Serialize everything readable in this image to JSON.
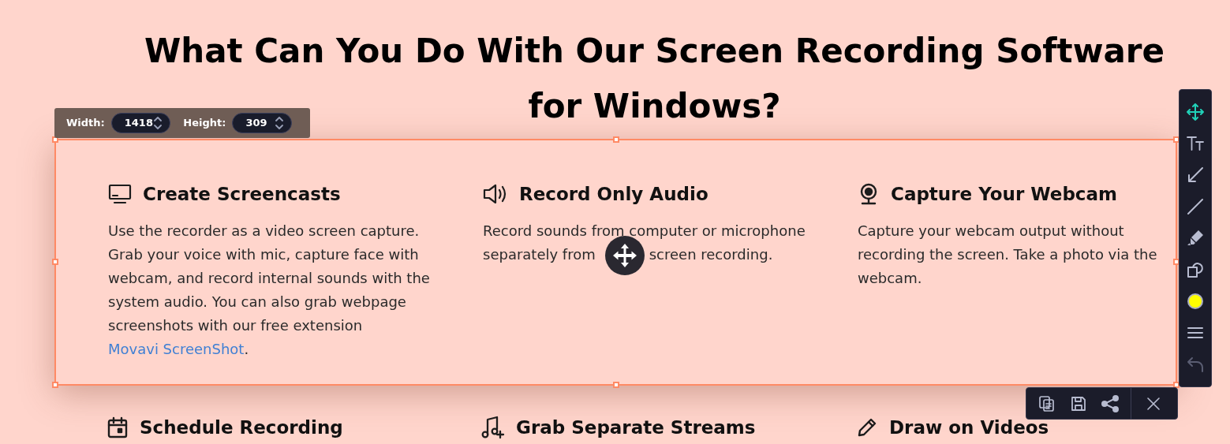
{
  "heading_lines": [
    "What Can You Do With Our Screen Recording Software",
    "for Windows?"
  ],
  "size_bar": {
    "width_label": "Width:",
    "width_value": "1418",
    "height_label": "Height:",
    "height_value": "309"
  },
  "features": [
    {
      "title": "Create Screencasts",
      "parts": [
        {
          "kind": "text",
          "text": "Use the recorder as a video screen capture. Grab your voice with mic, capture face with webcam, and record internal sounds with the system audio. You can also grab webpage screenshots with our free extension "
        },
        {
          "kind": "link",
          "text": "Movavi ScreenShot"
        },
        {
          "kind": "text",
          "text": "."
        }
      ]
    },
    {
      "title": "Record Only Audio",
      "parts": [
        {
          "kind": "text",
          "text": "Record sounds from computer or microphone"
        },
        {
          "kind": "text",
          "text": "separately from"
        },
        {
          "kind": "move_handle"
        },
        {
          "kind": "text",
          "text": "screen recording."
        }
      ]
    },
    {
      "title": "Capture Your Webcam",
      "parts": [
        {
          "kind": "text",
          "text": "Capture your webcam output without recording the screen. Take a photo via the webcam."
        }
      ]
    }
  ],
  "more_features": [
    {
      "title": "Schedule Recording"
    },
    {
      "title": "Grab Separate Streams"
    },
    {
      "title": "Draw on Videos"
    }
  ],
  "tools": [
    {
      "kind": "move",
      "selected": true,
      "disabled": false
    },
    {
      "kind": "text",
      "selected": false,
      "disabled": false
    },
    {
      "kind": "arrow",
      "selected": false,
      "disabled": false
    },
    {
      "kind": "line",
      "selected": false,
      "disabled": false
    },
    {
      "kind": "marker",
      "selected": false,
      "disabled": false
    },
    {
      "kind": "shapes",
      "selected": false,
      "disabled": false
    },
    {
      "kind": "color",
      "selected": false,
      "disabled": false,
      "color": "#ffff00"
    },
    {
      "kind": "thickness",
      "selected": false,
      "disabled": false
    },
    {
      "kind": "undo",
      "selected": false,
      "disabled": true
    }
  ],
  "actions": [
    {
      "kind": "copy"
    },
    {
      "kind": "save"
    },
    {
      "kind": "share"
    },
    {
      "kind": "close"
    }
  ]
}
